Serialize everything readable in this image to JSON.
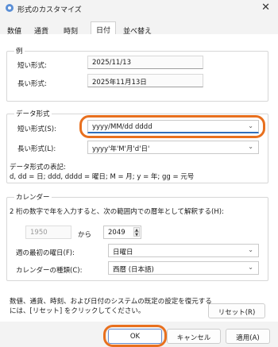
{
  "window": {
    "title": "形式のカスタマイズ",
    "icon": "gear-icon"
  },
  "tabs": [
    {
      "label": "数値",
      "active": false
    },
    {
      "label": "通貨",
      "active": false
    },
    {
      "label": "時刻",
      "active": false
    },
    {
      "label": "日付",
      "active": true
    },
    {
      "label": "並べ替え",
      "active": false
    }
  ],
  "example": {
    "group_label": "例",
    "short_label": "短い形式:",
    "short_value": "2025/11/13",
    "long_label": "長い形式:",
    "long_value": "2025年11月13日"
  },
  "data_format": {
    "group_label": "データ形式",
    "short_label": "短い形式(S):",
    "short_value": "yyyy/MM/dd dddd",
    "long_label": "長い形式(L):",
    "long_value": "yyyy'年'M'月'd'日'",
    "notation_title": "データ形式の表記:",
    "notation_text": "d, dd = 日;  ddd, dddd = 曜日; M = 月; y = 年; gg = 元号"
  },
  "calendar": {
    "group_label": "カレンダー",
    "description": "2 桁の数字で年を入力すると、次の範囲内での暦年として解釈する(H):",
    "from_value": "1950",
    "to_label": "から",
    "to_value": "2049",
    "first_day_label": "週の最初の曜日(F):",
    "first_day_value": "日曜日",
    "type_label": "カレンダーの種類(C):",
    "type_value": "西暦 (日本語)"
  },
  "footer": {
    "reset_text_line1": "数値、通貨、時刻、および日付のシステムの既定の設定を復元する",
    "reset_text_line2": "には、[リセット] をクリックしてください。",
    "reset_button": "リセット(R)"
  },
  "buttons": {
    "ok": "OK",
    "cancel": "キャンセル",
    "apply": "適用(A)"
  },
  "colors": {
    "highlight": "#e8701f",
    "focus": "#2f6ebb",
    "panel": "#ffffff",
    "chrome": "#f3f3f3"
  }
}
